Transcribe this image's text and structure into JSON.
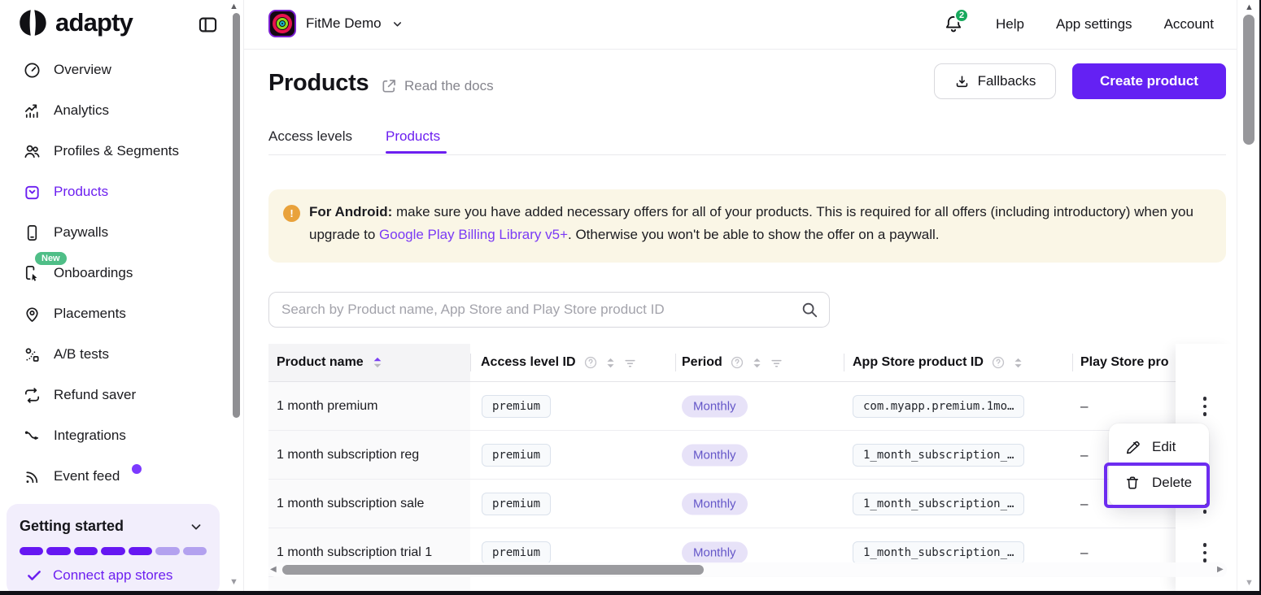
{
  "colors": {
    "accent_purple": "#6c1ff0",
    "create_button": "#6421f3",
    "highlight_border": "#6d2cf0",
    "banner_background": "#faf6e6",
    "warning_icon": "#e9a23b",
    "notification_badge": "#18a95d",
    "new_badge": "#4fbe87",
    "period_pill_bg": "#e7e2f8",
    "period_pill_text": "#6456c8"
  },
  "sidebar": {
    "logo_text": "adapty",
    "items": [
      {
        "label": "Overview"
      },
      {
        "label": "Analytics"
      },
      {
        "label": "Profiles & Segments"
      },
      {
        "label": "Products",
        "active": true
      },
      {
        "label": "Paywalls"
      },
      {
        "label": "Onboardings",
        "badge": "New"
      },
      {
        "label": "Placements"
      },
      {
        "label": "A/B tests"
      },
      {
        "label": "Refund saver"
      },
      {
        "label": "Integrations"
      },
      {
        "label": "Event feed",
        "dot": true
      }
    ],
    "getting_started": {
      "title": "Getting started",
      "progress_filled": 5,
      "progress_total": 7,
      "link": "Connect app stores"
    }
  },
  "topbar": {
    "app_name": "FitMe Demo",
    "notification_count": "2",
    "links": [
      "Help",
      "App settings",
      "Account"
    ]
  },
  "page": {
    "title": "Products",
    "docs_link": "Read the docs",
    "fallbacks_label": "Fallbacks",
    "create_label": "Create product",
    "tabs": [
      {
        "label": "Access levels",
        "active": false
      },
      {
        "label": "Products",
        "active": true
      }
    ]
  },
  "banner": {
    "bold": "For Android:",
    "text1": " make sure you have added necessary offers for all of your products. This is required for all offers (including introductory) when you upgrade to ",
    "link_text": "Google Play Billing Library v5+",
    "text2": ". Otherwise you won't be able to show the offer on a paywall."
  },
  "search": {
    "placeholder": "Search by Product name, App Store and Play Store product ID"
  },
  "table": {
    "columns": [
      {
        "label": "Product name",
        "sorted": "asc"
      },
      {
        "label": "Access level ID",
        "help": true,
        "sort": true,
        "filter": true
      },
      {
        "label": "Period",
        "help": true,
        "sort": true,
        "filter": true
      },
      {
        "label": "App Store product ID",
        "help": true,
        "sort": true
      },
      {
        "label": "Play Store pro",
        "truncated": true
      }
    ],
    "rows": [
      {
        "name": "1 month premium",
        "access_level": "premium",
        "period": "Monthly",
        "app_store_id": "com.myapp.premium.1mo…",
        "play_store_id": "–"
      },
      {
        "name": "1 month subscription reg",
        "access_level": "premium",
        "period": "Monthly",
        "app_store_id": "1_month_subscription_…",
        "play_store_id": "–"
      },
      {
        "name": "1 month subscription sale",
        "access_level": "premium",
        "period": "Monthly",
        "app_store_id": "1_month_subscription_…",
        "play_store_id": "–"
      },
      {
        "name": "1 month subscription trial 1",
        "access_level": "premium",
        "period": "Monthly",
        "app_store_id": "1_month_subscription_…",
        "play_store_id": "–"
      }
    ]
  },
  "menu": {
    "items": [
      {
        "label": "Edit"
      },
      {
        "label": "Delete"
      }
    ]
  }
}
